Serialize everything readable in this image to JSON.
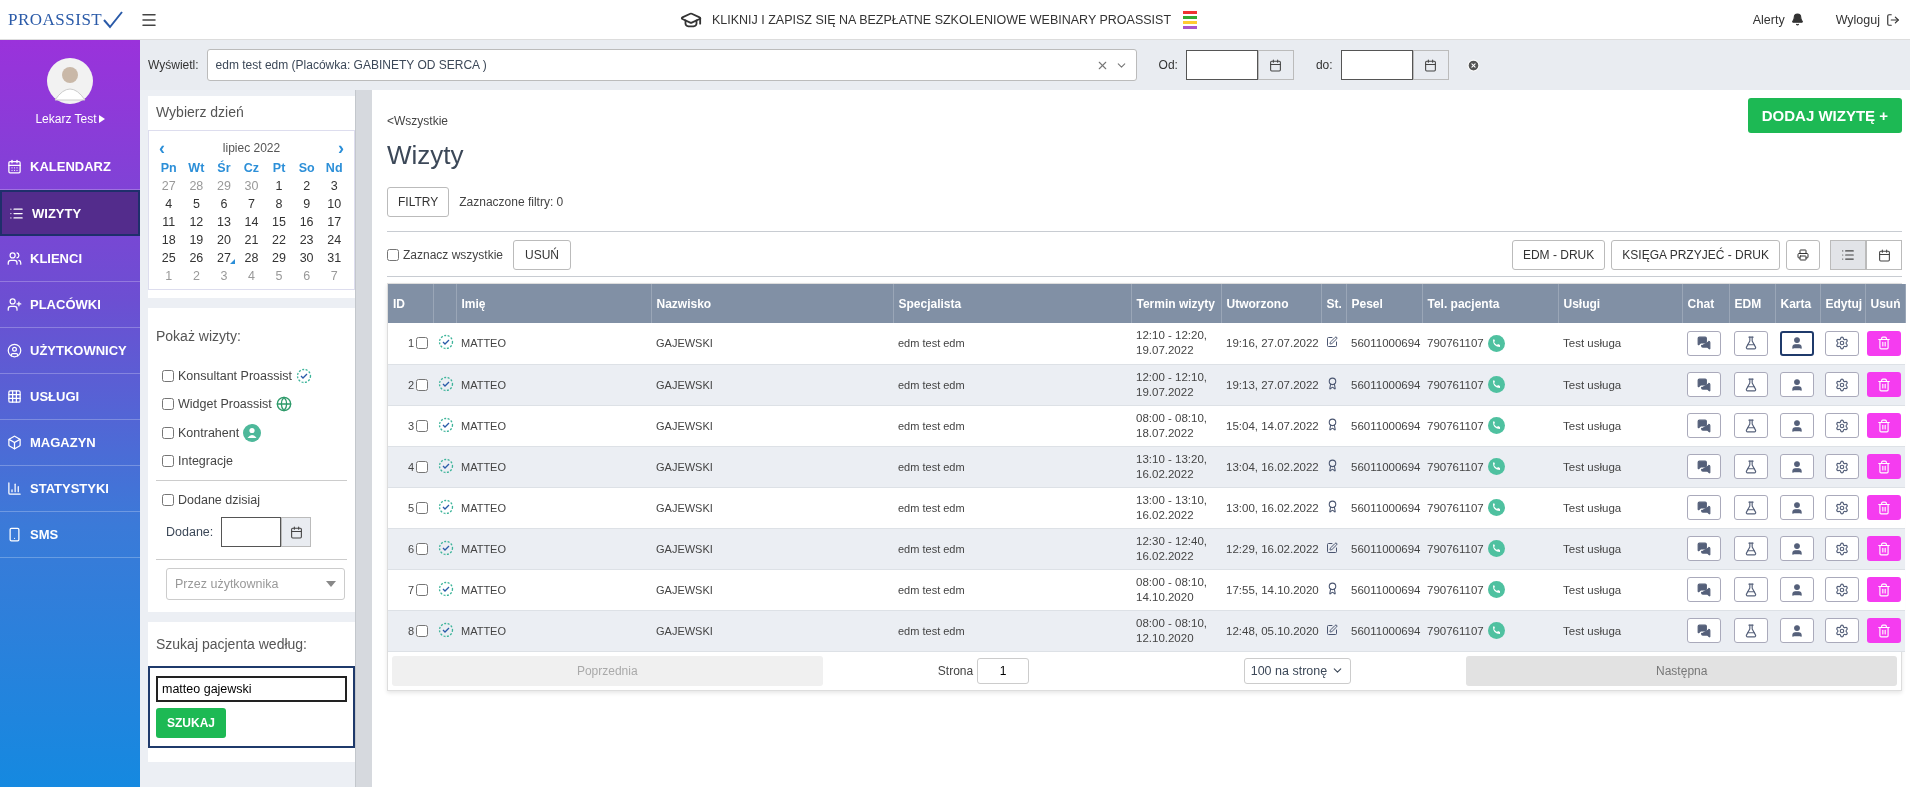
{
  "topbar": {
    "logo": "PROASSIST",
    "banner": "KLIKNIJ I ZAPISZ SIĘ NA BEZPŁATNE SZKOLENIOWE WEBINARY PROASSIST",
    "alerts": "Alerty",
    "logout": "Wyloguj"
  },
  "profile": {
    "name": "Lekarz Test"
  },
  "nav": [
    {
      "label": "KALENDARZ",
      "selected": false
    },
    {
      "label": "WIZYTY",
      "selected": true
    },
    {
      "label": "KLIENCI",
      "selected": false
    },
    {
      "label": "PLACÓWKI",
      "selected": false
    },
    {
      "label": "UŻYTKOWNICY",
      "selected": false
    },
    {
      "label": "USŁUGI",
      "selected": false
    },
    {
      "label": "MAGAZYN",
      "selected": false
    },
    {
      "label": "STATYSTYKI",
      "selected": false
    },
    {
      "label": "SMS",
      "selected": false
    }
  ],
  "filter_bar": {
    "label": "Wyświetl:",
    "value": "edm test edm (Placówka: GABINETY OD SERCA )",
    "from_label": "Od:",
    "to_label": "do:"
  },
  "calendar": {
    "title": "Wybierz dzień",
    "month": "lipiec 2022",
    "prev": "‹",
    "next": "›",
    "weekdays": [
      "Pn",
      "Wt",
      "Śr",
      "Cz",
      "Pt",
      "So",
      "Nd"
    ],
    "weeks": [
      [
        {
          "d": "27",
          "muted": true
        },
        {
          "d": "28",
          "muted": true
        },
        {
          "d": "29",
          "muted": true
        },
        {
          "d": "30",
          "muted": true
        },
        {
          "d": "1",
          "muted": false
        },
        {
          "d": "2",
          "muted": false
        },
        {
          "d": "3",
          "muted": false
        }
      ],
      [
        {
          "d": "4",
          "muted": false
        },
        {
          "d": "5",
          "muted": false
        },
        {
          "d": "6",
          "muted": false
        },
        {
          "d": "7",
          "muted": false
        },
        {
          "d": "8",
          "muted": false
        },
        {
          "d": "9",
          "muted": false
        },
        {
          "d": "10",
          "muted": false
        }
      ],
      [
        {
          "d": "11",
          "muted": false
        },
        {
          "d": "12",
          "muted": false
        },
        {
          "d": "13",
          "muted": false
        },
        {
          "d": "14",
          "muted": false
        },
        {
          "d": "15",
          "muted": false
        },
        {
          "d": "16",
          "muted": false
        },
        {
          "d": "17",
          "muted": false
        }
      ],
      [
        {
          "d": "18",
          "muted": false
        },
        {
          "d": "19",
          "muted": false
        },
        {
          "d": "20",
          "muted": false
        },
        {
          "d": "21",
          "muted": false
        },
        {
          "d": "22",
          "muted": false
        },
        {
          "d": "23",
          "muted": false
        },
        {
          "d": "24",
          "muted": false
        }
      ],
      [
        {
          "d": "25",
          "muted": false
        },
        {
          "d": "26",
          "muted": false
        },
        {
          "d": "27",
          "muted": false,
          "today": true
        },
        {
          "d": "28",
          "muted": false
        },
        {
          "d": "29",
          "muted": false
        },
        {
          "d": "30",
          "muted": false
        },
        {
          "d": "31",
          "muted": false
        }
      ],
      [
        {
          "d": "1",
          "muted": true
        },
        {
          "d": "2",
          "muted": true
        },
        {
          "d": "3",
          "muted": true
        },
        {
          "d": "4",
          "muted": true
        },
        {
          "d": "5",
          "muted": true
        },
        {
          "d": "6",
          "muted": true
        },
        {
          "d": "7",
          "muted": true
        }
      ]
    ]
  },
  "show_visits": {
    "title": "Pokaż wizyty:",
    "filters": [
      {
        "label": "Konsultant Proassist",
        "kind": "consultant",
        "checked": false
      },
      {
        "label": "Widget Proassist",
        "kind": "widget",
        "checked": false
      },
      {
        "label": "Kontrahent",
        "kind": "contractor",
        "checked": false
      },
      {
        "label": "Integracje",
        "kind": "plain",
        "checked": false
      }
    ],
    "added_today": {
      "label": "Dodane dzisiaj",
      "checked": false
    },
    "added_label": "Dodane:",
    "user_select": {
      "placeholder": "Przez użytkownika"
    }
  },
  "patient_search": {
    "title": "Szukaj pacjenta według:",
    "value": "matteo gajewski",
    "button": "SZUKAJ"
  },
  "main": {
    "back": "<Wszystkie",
    "title": "Wizyty",
    "add_button": "DODAJ WIZYTĘ +",
    "filters_button": "FILTRY",
    "filters_count": "Zaznaczone filtry: 0",
    "select_all": {
      "label": "Zaznacz wszystkie",
      "checked": false
    },
    "delete_button": "USUŃ",
    "edm_print": "EDM - DRUK",
    "book_print": "KSIĘGA PRZYJEĆ - DRUK",
    "views": [
      {
        "kind": "list",
        "selected": true
      },
      {
        "kind": "calendar",
        "selected": false
      }
    ]
  },
  "table": {
    "columns": [
      "ID",
      "",
      "Imię",
      "Nazwisko",
      "Specjalista",
      "Termin wizyty",
      "Utworzono",
      "St.",
      "Pesel",
      "Tel. pacjenta",
      "Usługi",
      "Chat",
      "EDM",
      "Karta",
      "Edytuj",
      "Usuń"
    ],
    "rows": [
      {
        "id": "1",
        "checked": false,
        "first": "MATTEO",
        "last": "GAJEWSKI",
        "specialist": "edm test edm",
        "term": [
          "12:10 - 12:20,",
          "19.07.2022"
        ],
        "created": "19:16, 27.07.2022",
        "status": {
          "kind": "edited"
        },
        "pesel": "56011000694",
        "phone": "790761107",
        "service": "Test usługa",
        "card_focused": true
      },
      {
        "id": "2",
        "checked": false,
        "first": "MATTEO",
        "last": "GAJEWSKI",
        "specialist": "edm test edm",
        "term": [
          "12:00 - 12:10,",
          "19.07.2022"
        ],
        "created": "19:13, 27.07.2022",
        "status": {
          "kind": "awarded"
        },
        "pesel": "56011000694",
        "phone": "790761107",
        "service": "Test usługa",
        "card_focused": false
      },
      {
        "id": "3",
        "checked": false,
        "first": "MATTEO",
        "last": "GAJEWSKI",
        "specialist": "edm test edm",
        "term": [
          "08:00 - 08:10,",
          "18.07.2022"
        ],
        "created": "15:04, 14.07.2022",
        "status": {
          "kind": "awarded"
        },
        "pesel": "56011000694",
        "phone": "790761107",
        "service": "Test usługa",
        "card_focused": false
      },
      {
        "id": "4",
        "checked": false,
        "first": "MATTEO",
        "last": "GAJEWSKI",
        "specialist": "edm test edm",
        "term": [
          "13:10 - 13:20,",
          "16.02.2022"
        ],
        "created": "13:04, 16.02.2022",
        "status": {
          "kind": "awarded"
        },
        "pesel": "56011000694",
        "phone": "790761107",
        "service": "Test usługa",
        "card_focused": false
      },
      {
        "id": "5",
        "checked": false,
        "first": "MATTEO",
        "last": "GAJEWSKI",
        "specialist": "edm test edm",
        "term": [
          "13:00 - 13:10,",
          "16.02.2022"
        ],
        "created": "13:00, 16.02.2022",
        "status": {
          "kind": "awarded"
        },
        "pesel": "56011000694",
        "phone": "790761107",
        "service": "Test usługa",
        "card_focused": false
      },
      {
        "id": "6",
        "checked": false,
        "first": "MATTEO",
        "last": "GAJEWSKI",
        "specialist": "edm test edm",
        "term": [
          "12:30 - 12:40,",
          "16.02.2022"
        ],
        "created": "12:29, 16.02.2022",
        "status": {
          "kind": "edited"
        },
        "pesel": "56011000694",
        "phone": "790761107",
        "service": "Test usługa",
        "card_focused": false
      },
      {
        "id": "7",
        "checked": false,
        "first": "MATTEO",
        "last": "GAJEWSKI",
        "specialist": "edm test edm",
        "term": [
          "08:00 - 08:10,",
          "14.10.2020"
        ],
        "created": "17:55, 14.10.2020",
        "status": {
          "kind": "awarded"
        },
        "pesel": "56011000694",
        "phone": "790761107",
        "service": "Test usługa",
        "card_focused": false
      },
      {
        "id": "8",
        "checked": false,
        "first": "MATTEO",
        "last": "GAJEWSKI",
        "specialist": "edm test edm",
        "term": [
          "08:00 - 08:10,",
          "12.10.2020"
        ],
        "created": "12:48, 05.10.2020",
        "status": {
          "kind": "edited"
        },
        "pesel": "56011000694",
        "phone": "790761107",
        "service": "Test usługa",
        "card_focused": false
      }
    ]
  },
  "pagination": {
    "prev": {
      "label": "Poprzednia",
      "disabled": true
    },
    "page_label": "Strona",
    "page": "1",
    "per_page": "100 na stronę",
    "next": {
      "label": "Następna",
      "disabled": false
    }
  }
}
